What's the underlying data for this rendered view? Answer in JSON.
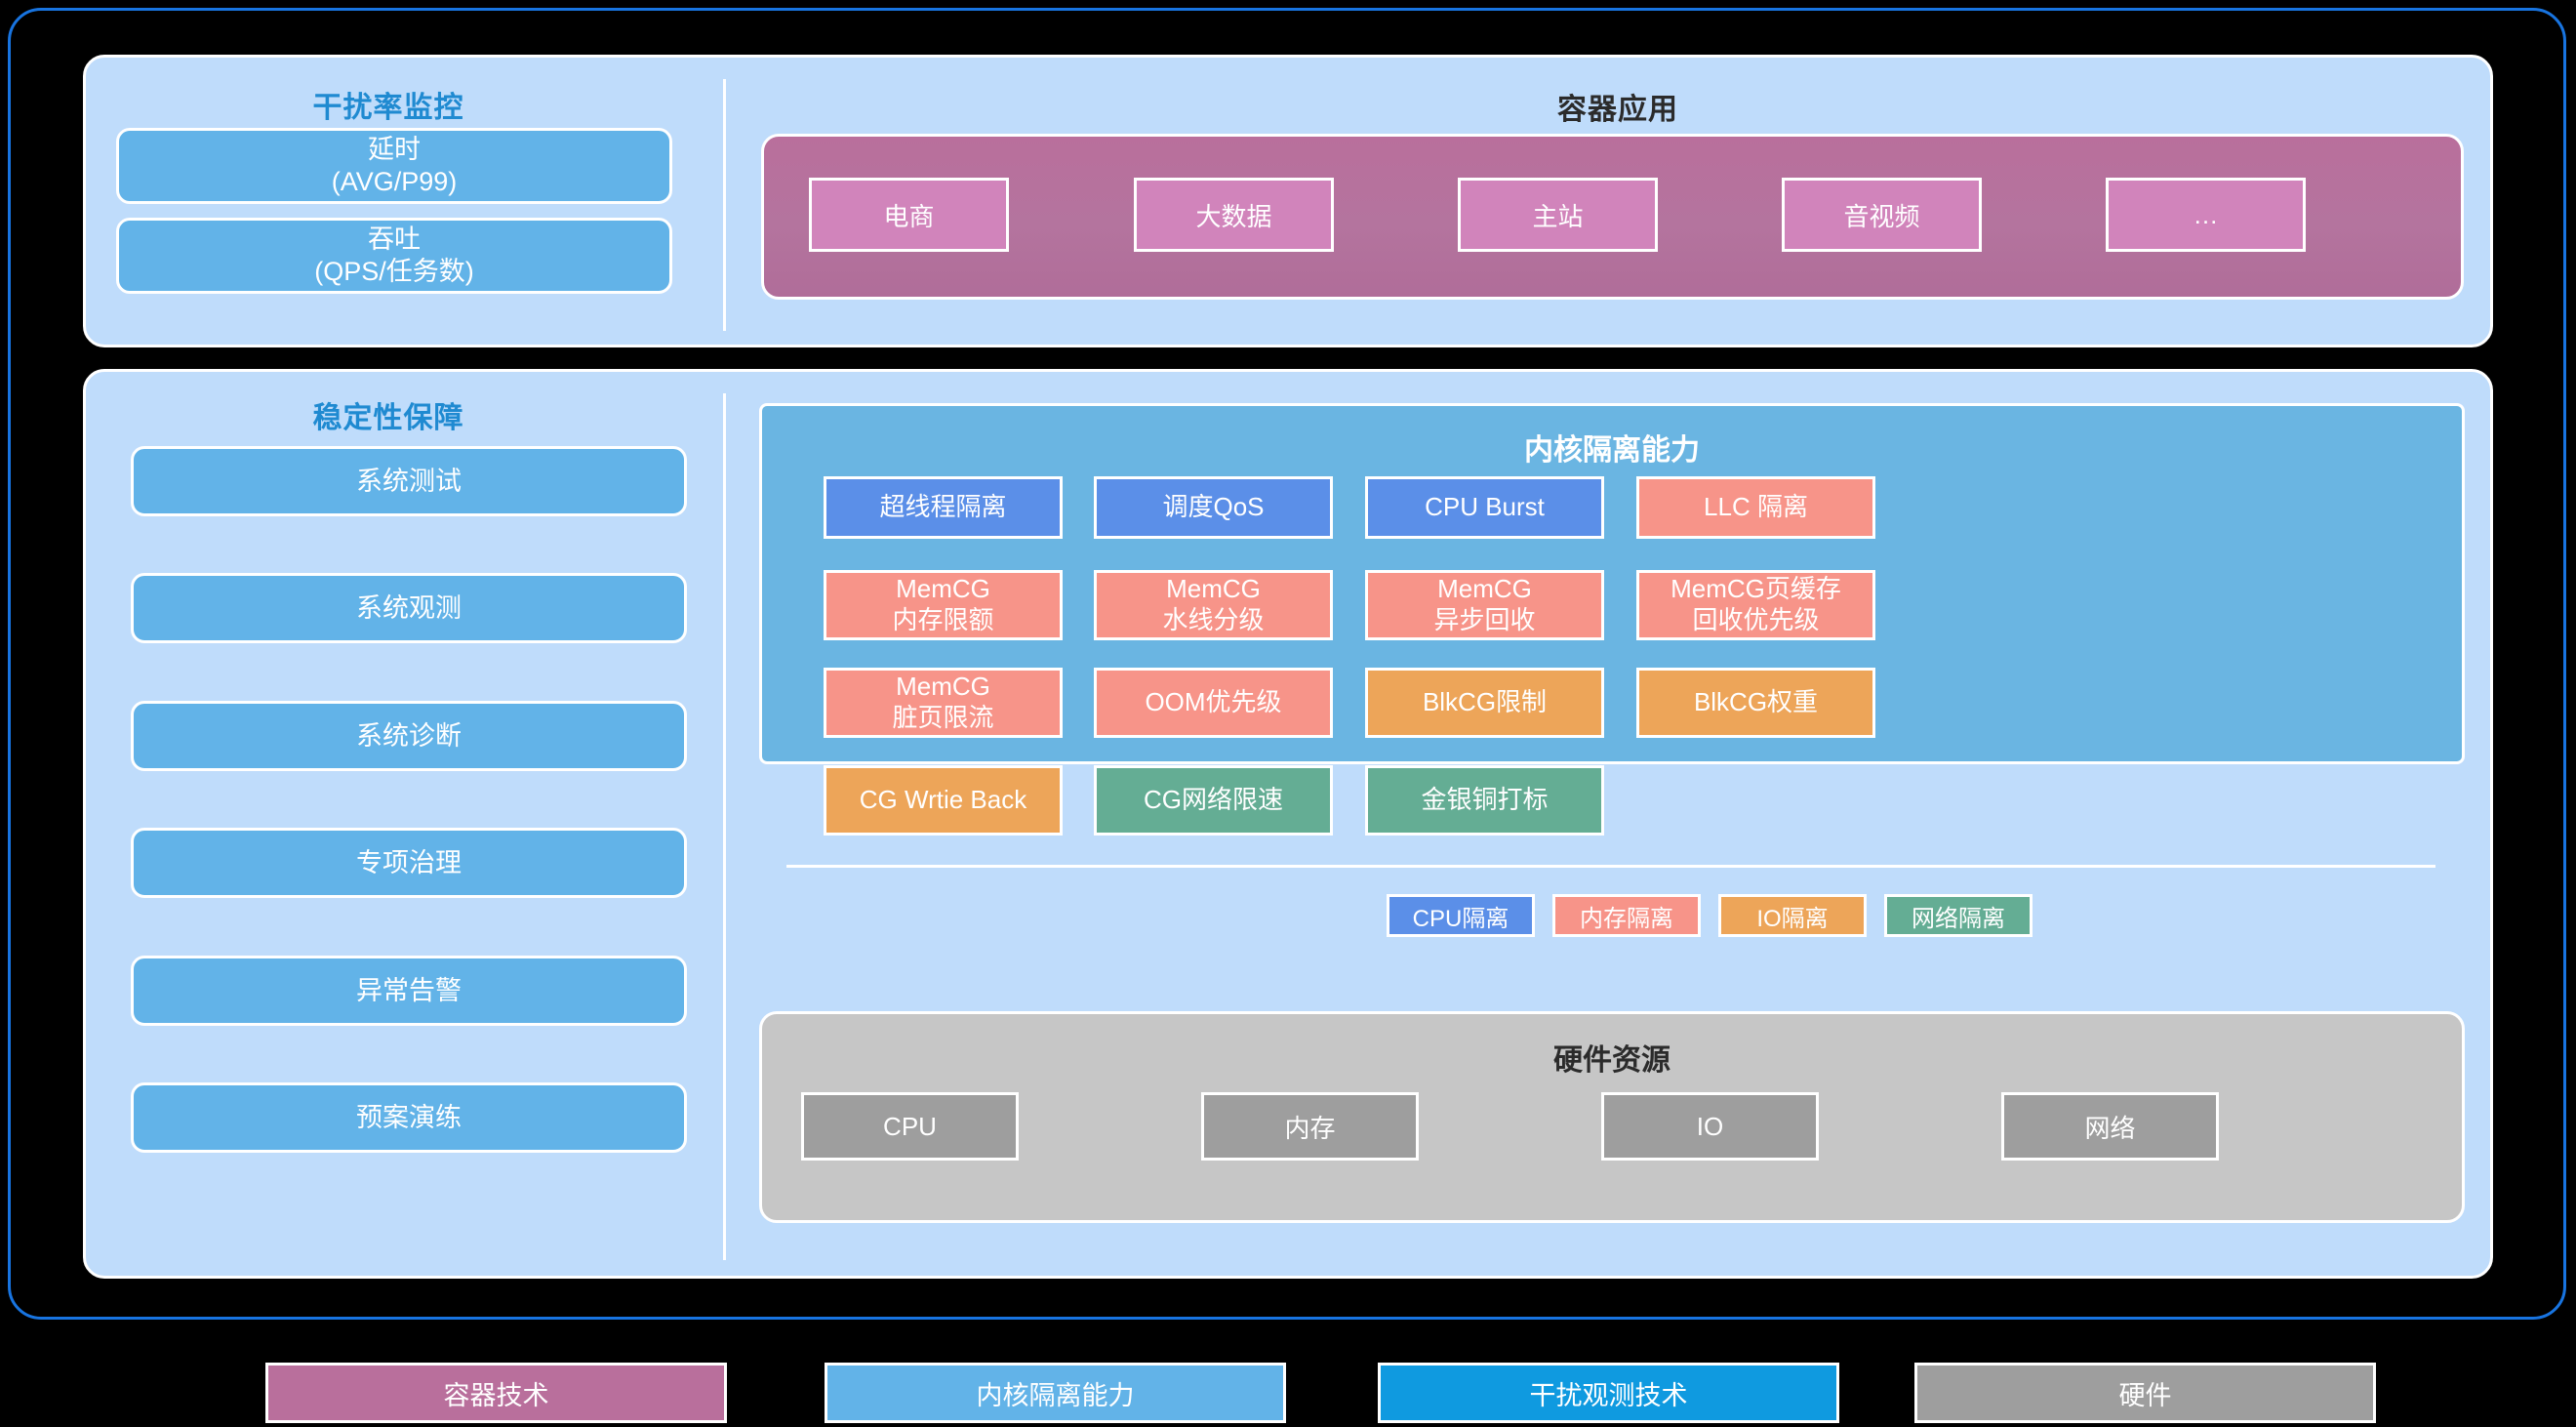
{
  "colors": {
    "background": "#000000",
    "frame_border": "#1874e0",
    "panel_bg": "#bfdcfb",
    "pill_blue": "#62b3e8",
    "title_blue": "#1f8ad1",
    "container_pink": "#b4749e",
    "app_chip_pink": "#d184bb",
    "kernel_bg": "#6ab5e2",
    "cpu_blue": "#5b8fe8",
    "mem_red": "#f79489",
    "io_orange": "#eda559",
    "net_green": "#64ad94",
    "hardware_grey": "#c6c6c6",
    "hw_chip_grey": "#9e9e9e",
    "observe_blue": "#0f9ae0"
  },
  "top_panel": {
    "left": {
      "title": "干扰率监控",
      "items": [
        {
          "line1": "延时",
          "line2": "(AVG/P99)"
        },
        {
          "line1": "吞吐",
          "line2": "(QPS/任务数)"
        }
      ]
    },
    "right": {
      "title": "容器应用",
      "apps": [
        "电商",
        "大数据",
        "主站",
        "音视频",
        "…"
      ]
    }
  },
  "bottom_panel": {
    "left": {
      "title": "稳定性保障",
      "items": [
        "系统测试",
        "系统观测",
        "系统诊断",
        "专项治理",
        "异常告警",
        "预案演练"
      ]
    },
    "kernel": {
      "title": "内核隔离能力",
      "cells": [
        {
          "line1": "超线程隔离",
          "line2": "",
          "kind": "cpu"
        },
        {
          "line1": "调度QoS",
          "line2": "",
          "kind": "cpu"
        },
        {
          "line1": "CPU Burst",
          "line2": "",
          "kind": "cpu"
        },
        {
          "line1": "LLC 隔离",
          "line2": "",
          "kind": "mem"
        },
        {
          "line1": "MemCG",
          "line2": "内存限额",
          "kind": "mem"
        },
        {
          "line1": "MemCG",
          "line2": "水线分级",
          "kind": "mem"
        },
        {
          "line1": "MemCG",
          "line2": "异步回收",
          "kind": "mem"
        },
        {
          "line1": "MemCG页缓存",
          "line2": "回收优先级",
          "kind": "mem"
        },
        {
          "line1": "MemCG",
          "line2": "脏页限流",
          "kind": "mem"
        },
        {
          "line1": "OOM优先级",
          "line2": "",
          "kind": "mem"
        },
        {
          "line1": "BlkCG限制",
          "line2": "",
          "kind": "io"
        },
        {
          "line1": "BlkCG权重",
          "line2": "",
          "kind": "io"
        },
        {
          "line1": "CG Wrtie Back",
          "line2": "",
          "kind": "io"
        },
        {
          "line1": "CG网络限速",
          "line2": "",
          "kind": "net"
        },
        {
          "line1": "金银铜打标",
          "line2": "",
          "kind": "net"
        }
      ],
      "legend": [
        {
          "label": "CPU隔离",
          "kind": "cpu"
        },
        {
          "label": "内存隔离",
          "kind": "mem"
        },
        {
          "label": "IO隔离",
          "kind": "io"
        },
        {
          "label": "网络隔离",
          "kind": "net"
        }
      ]
    },
    "hardware": {
      "title": "硬件资源",
      "items": [
        "CPU",
        "内存",
        "IO",
        "网络"
      ]
    }
  },
  "bottom_legend": [
    {
      "label": "容器技术",
      "kind": "container"
    },
    {
      "label": "内核隔离能力",
      "kind": "kernel"
    },
    {
      "label": "干扰观测技术",
      "kind": "observe"
    },
    {
      "label": "硬件",
      "kind": "hardware"
    }
  ]
}
